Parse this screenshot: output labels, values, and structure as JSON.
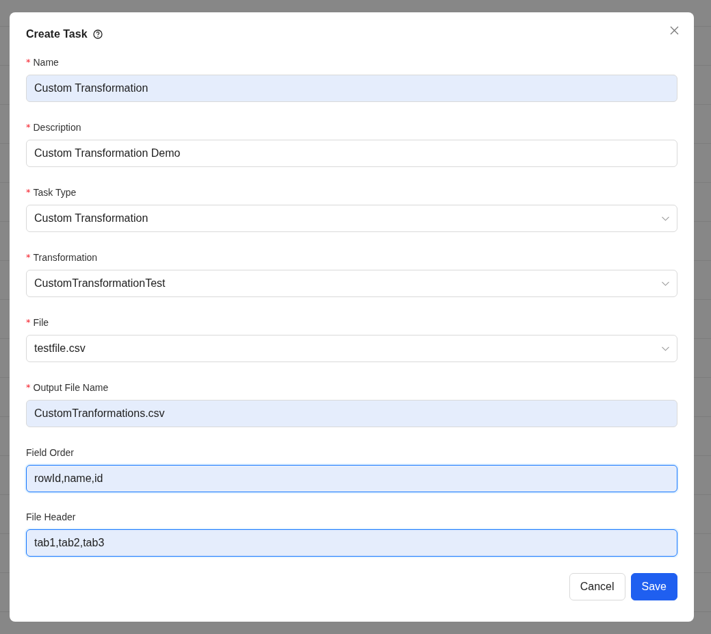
{
  "dialog": {
    "title": "Create Task",
    "fields": [
      {
        "required_mark": "*",
        "label": "Name",
        "kind": "input",
        "value": "Custom Transformation",
        "autofilled": true,
        "focused": false
      },
      {
        "required_mark": "*",
        "label": "Description",
        "kind": "input",
        "value": "Custom Transformation Demo",
        "autofilled": false,
        "focused": false
      },
      {
        "required_mark": "*",
        "label": "Task Type",
        "kind": "select",
        "value": "Custom Transformation",
        "autofilled": false,
        "focused": false
      },
      {
        "required_mark": "*",
        "label": "Transformation",
        "kind": "select",
        "value": "CustomTransformationTest",
        "autofilled": false,
        "focused": false
      },
      {
        "required_mark": "*",
        "label": "File",
        "kind": "select",
        "value": "testfile.csv",
        "autofilled": false,
        "focused": false
      },
      {
        "required_mark": "*",
        "label": "Output File Name",
        "kind": "input",
        "value": "CustomTranformations.csv",
        "autofilled": true,
        "focused": false
      },
      {
        "label": "Field Order",
        "kind": "input",
        "value": "rowId,name,id",
        "autofilled": true,
        "focused": true
      },
      {
        "label": "File Header",
        "kind": "input",
        "value": "tab1,tab2,tab3",
        "autofilled": true,
        "focused": true
      }
    ],
    "buttons": [
      {
        "label": "Cancel",
        "kind": "secondary"
      },
      {
        "label": "Save",
        "kind": "primary"
      }
    ]
  }
}
